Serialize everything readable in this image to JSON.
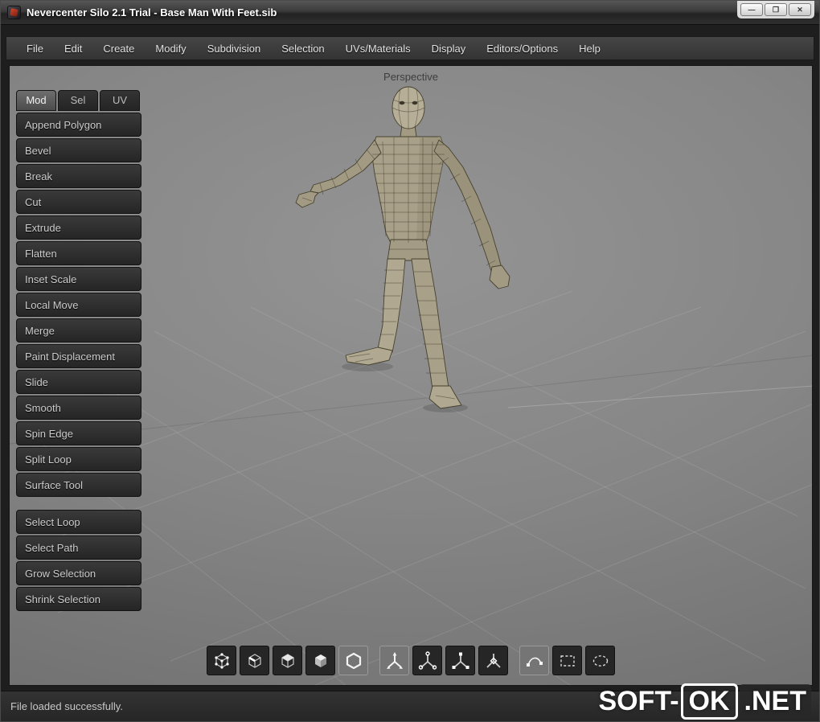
{
  "window": {
    "title": "Nevercenter Silo 2.1 Trial - Base Man With Feet.sib",
    "controls": {
      "minimize": "—",
      "maximize": "❐",
      "close": "✕"
    }
  },
  "menu": {
    "items": [
      "File",
      "Edit",
      "Create",
      "Modify",
      "Subdivision",
      "Selection",
      "UVs/Materials",
      "Display",
      "Editors/Options",
      "Help"
    ]
  },
  "viewport": {
    "label": "Perspective"
  },
  "sidebar": {
    "tabs": [
      {
        "label": "Mod",
        "active": true
      },
      {
        "label": "Sel",
        "active": false
      },
      {
        "label": "UV",
        "active": false
      }
    ],
    "tools": [
      "Append Polygon",
      "Bevel",
      "Break",
      "Cut",
      "Extrude",
      "Flatten",
      "Inset Scale",
      "Local Move",
      "Merge",
      "Paint Displacement",
      "Slide",
      "Smooth",
      "Spin Edge",
      "Split Loop",
      "Surface Tool"
    ],
    "selection_tools": [
      "Select Loop",
      "Select Path",
      "Grow Selection",
      "Shrink Selection"
    ]
  },
  "toolbar": {
    "icons": [
      {
        "name": "vertex-mode",
        "selected": false
      },
      {
        "name": "edge-mode",
        "selected": false
      },
      {
        "name": "face-mode",
        "selected": false
      },
      {
        "name": "object-mode",
        "selected": false
      },
      {
        "name": "polygon-mode",
        "selected": true
      },
      {
        "name": "move-manipulator",
        "selected": true
      },
      {
        "name": "rotate-manipulator",
        "selected": false
      },
      {
        "name": "scale-manipulator",
        "selected": false
      },
      {
        "name": "universal-manipulator",
        "selected": false
      },
      {
        "name": "curve-tool",
        "selected": true
      },
      {
        "name": "rectangle-select",
        "selected": false
      },
      {
        "name": "lasso-select",
        "selected": false
      }
    ]
  },
  "status": {
    "message": "File loaded successfully."
  },
  "watermark": {
    "prefix": "SOFT-",
    "boxed": "OK",
    "suffix": ".NET"
  },
  "colors": {
    "viewport_top": "#949494",
    "viewport_bottom": "#6d6d6d",
    "panel_dark": "#262626",
    "model_skin": "#aea688",
    "model_wire": "#46422f",
    "accent_red": "#d4452a"
  }
}
